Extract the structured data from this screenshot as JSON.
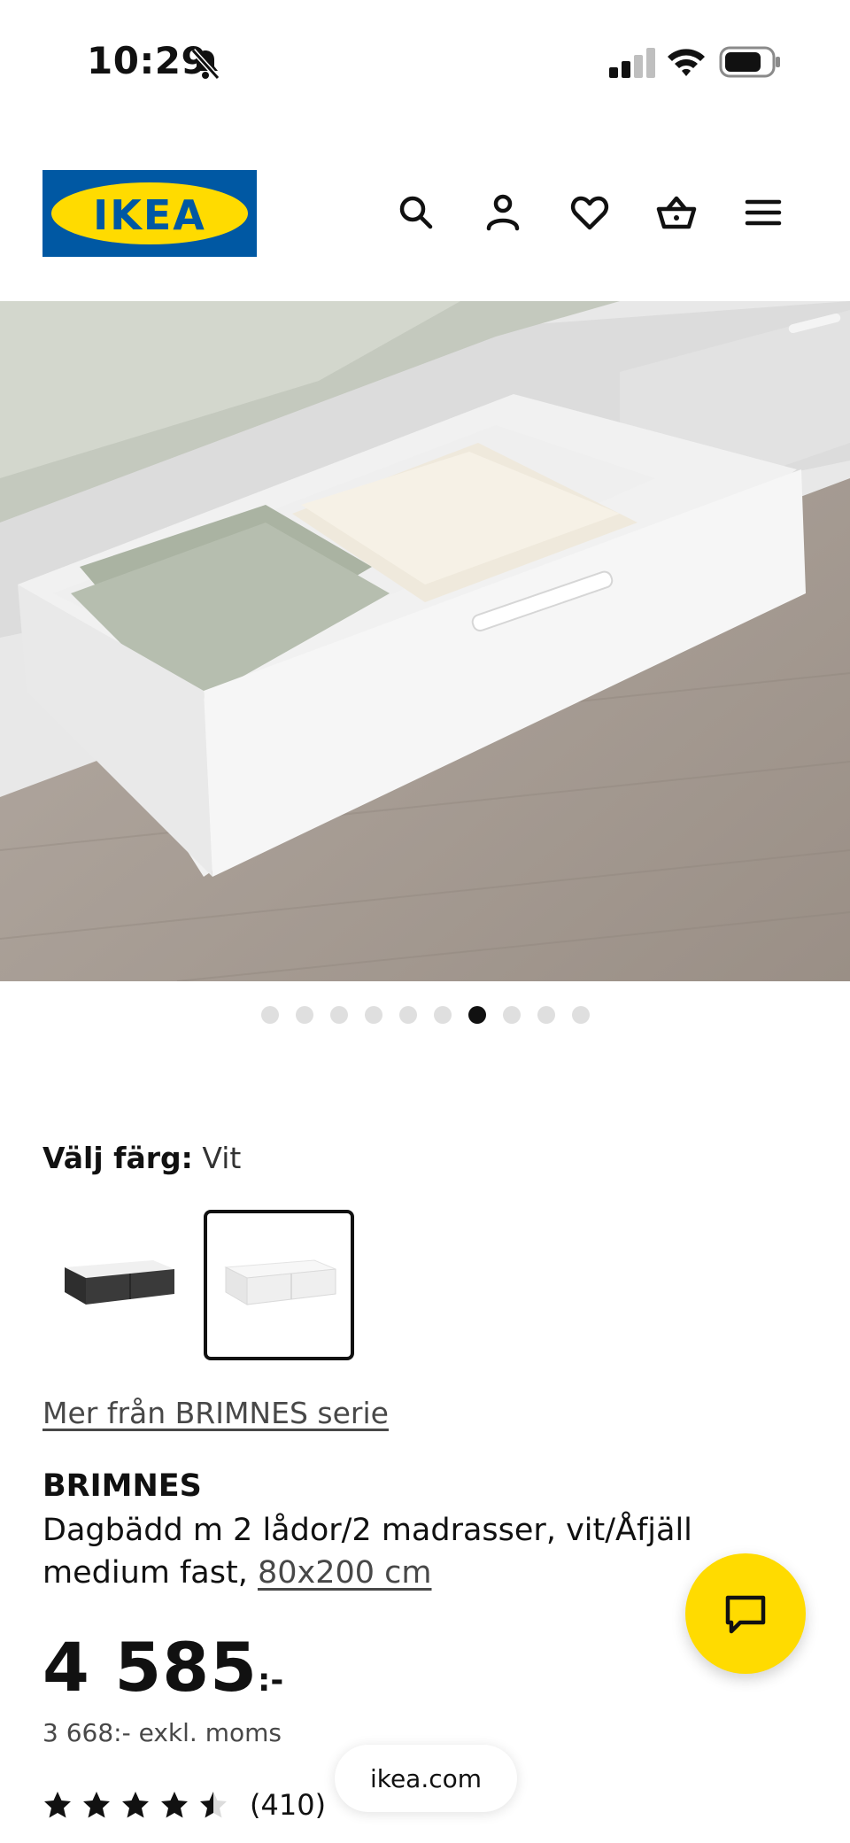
{
  "status_bar": {
    "time": "10:29"
  },
  "header": {
    "logo_text": "IKEA",
    "icons": [
      "search-icon",
      "user-icon",
      "heart-icon",
      "basket-icon",
      "menu-icon"
    ]
  },
  "gallery": {
    "total_images": 10,
    "active_index": 7
  },
  "color_select": {
    "label": "Välj färg:",
    "value": "Vit",
    "options": [
      "black-brown",
      "white"
    ],
    "selected": "white"
  },
  "series_link": "Mer från BRIMNES serie",
  "product": {
    "name": "BRIMNES",
    "description": "Dagbädd m 2 lådor/2 madrasser, vit/Åfjäll medium fast,",
    "size": "80x200 cm"
  },
  "price": {
    "amount": "4 585",
    "suffix": ":-",
    "excl_vat": "3 668:- exkl. moms"
  },
  "rating": {
    "stars": 4.5,
    "count": "(410)"
  },
  "browser": {
    "url": "ikea.com"
  },
  "colors": {
    "brand_blue": "#0058a3",
    "brand_yellow": "#ffdb00"
  }
}
